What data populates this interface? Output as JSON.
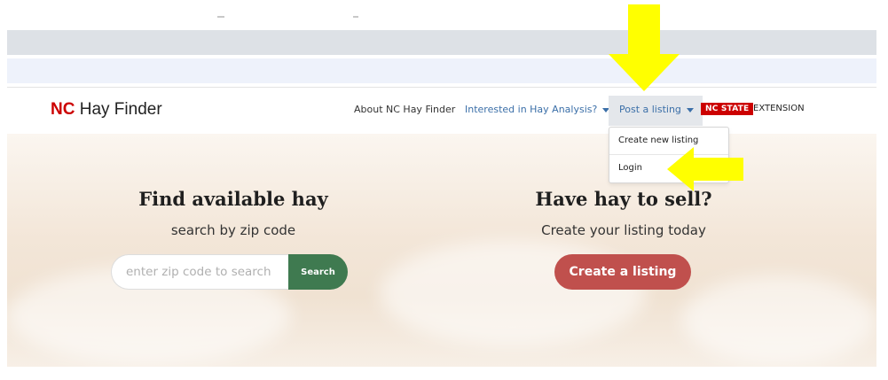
{
  "brand": {
    "prefix": "NC",
    "name": " Hay Finder"
  },
  "nav": {
    "about": "About NC Hay Finder",
    "analysis": "Interested in Hay Analysis?",
    "post": "Post a listing",
    "ncstate": "NC STATE",
    "extension": "EXTENSION"
  },
  "dropdown": {
    "items": [
      "Create new listing",
      "Login"
    ]
  },
  "hero": {
    "left": {
      "title": "Find available hay",
      "subtitle": "search by zip code",
      "search_placeholder": "enter zip code to search",
      "search_label": "Search"
    },
    "right": {
      "title": "Have hay to sell?",
      "subtitle": "Create your listing today",
      "create_label": "Create a listing"
    }
  },
  "colors": {
    "brand_red": "#cc0000",
    "search_green": "#3f7a50",
    "create_red": "#c0504d",
    "arrow_yellow": "#ffff00"
  },
  "annotations": [
    "down-arrow-icon",
    "left-arrow-icon"
  ]
}
